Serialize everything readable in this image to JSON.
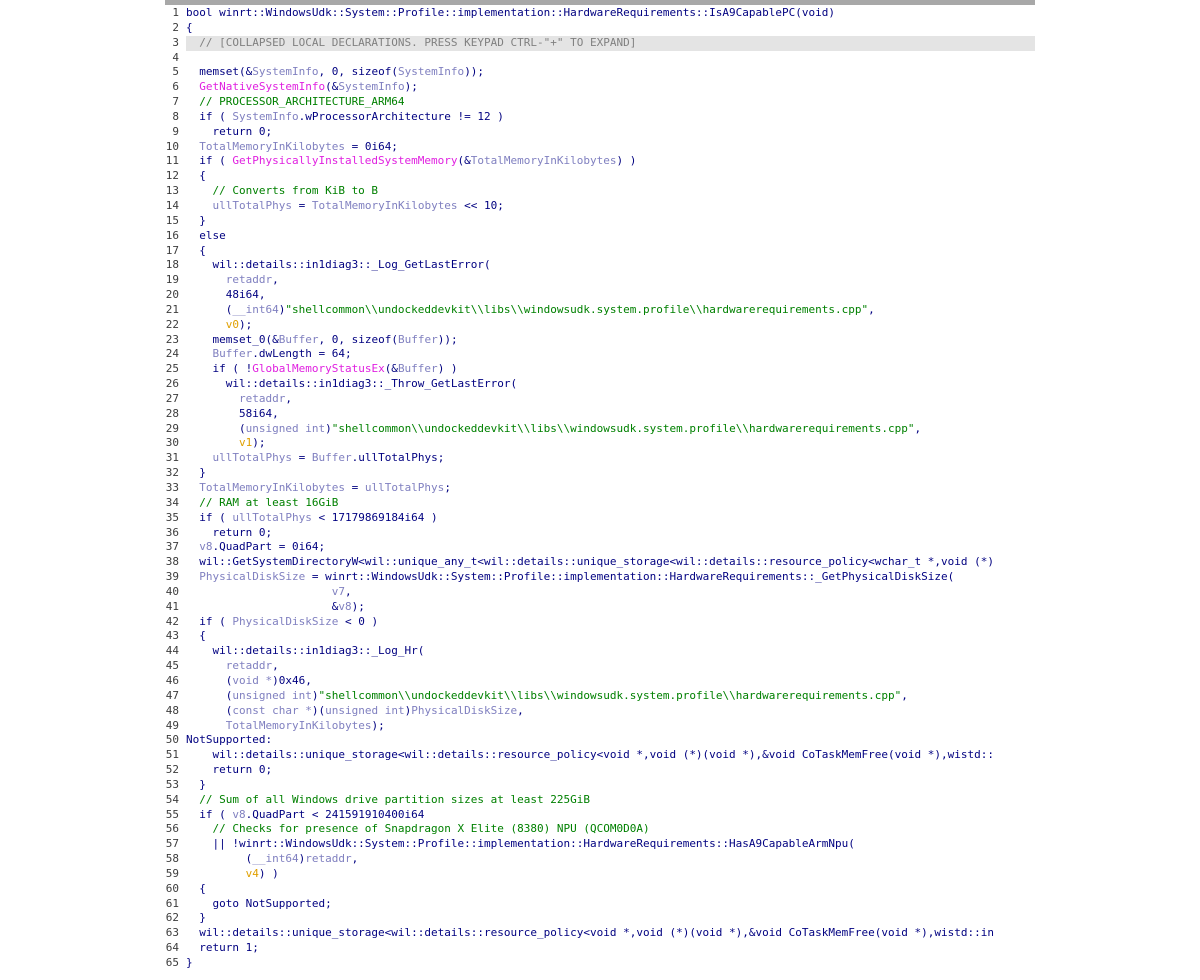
{
  "colors": {
    "plain": "#000080",
    "variable": "#8080c0",
    "import_function": "#e020e0",
    "comment": "#008000",
    "string": "#008000",
    "orange_variable": "#e0a000",
    "collapsed_text": "#808080",
    "collapsed_background": "#e4e4e4",
    "top_bar": "#a8a8a8"
  },
  "code_lines": [
    {
      "n": "1",
      "t": [
        [
          "p",
          "bool winrt::WindowsUdk::System::Profile::implementation::HardwareRequirements::IsA9CapablePC(void)"
        ]
      ]
    },
    {
      "n": "2",
      "t": [
        [
          "p",
          "{"
        ]
      ]
    },
    {
      "n": "3",
      "collapsed": true,
      "t": [
        [
          "g",
          "  // [COLLAPSED LOCAL DECLARATIONS. PRESS KEYPAD CTRL-\"+\" TO EXPAND]"
        ]
      ]
    },
    {
      "n": "4",
      "t": []
    },
    {
      "n": "5",
      "t": [
        [
          "p",
          "  memset(&"
        ],
        [
          "v",
          "SystemInfo"
        ],
        [
          "p",
          ", 0, sizeof("
        ],
        [
          "v",
          "SystemInfo"
        ],
        [
          "p",
          "));"
        ]
      ]
    },
    {
      "n": "6",
      "t": [
        [
          "p",
          "  "
        ],
        [
          "f",
          "GetNativeSystemInfo"
        ],
        [
          "p",
          "(&"
        ],
        [
          "v",
          "SystemInfo"
        ],
        [
          "p",
          ");"
        ]
      ]
    },
    {
      "n": "7",
      "t": [
        [
          "c",
          "  // PROCESSOR_ARCHITECTURE_ARM64"
        ]
      ]
    },
    {
      "n": "8",
      "t": [
        [
          "p",
          "  if ( "
        ],
        [
          "v",
          "SystemInfo"
        ],
        [
          "p",
          ".wProcessorArchitecture != 12 )"
        ]
      ]
    },
    {
      "n": "9",
      "t": [
        [
          "p",
          "    return 0;"
        ]
      ]
    },
    {
      "n": "10",
      "t": [
        [
          "p",
          "  "
        ],
        [
          "v",
          "TotalMemoryInKilobytes"
        ],
        [
          "p",
          " = 0i64;"
        ]
      ]
    },
    {
      "n": "11",
      "t": [
        [
          "p",
          "  if ( "
        ],
        [
          "f",
          "GetPhysicallyInstalledSystemMemory"
        ],
        [
          "p",
          "(&"
        ],
        [
          "v",
          "TotalMemoryInKilobytes"
        ],
        [
          "p",
          ") )"
        ]
      ]
    },
    {
      "n": "12",
      "t": [
        [
          "p",
          "  {"
        ]
      ]
    },
    {
      "n": "13",
      "t": [
        [
          "c",
          "    // Converts from KiB to B"
        ]
      ]
    },
    {
      "n": "14",
      "t": [
        [
          "p",
          "    "
        ],
        [
          "v",
          "ullTotalPhys"
        ],
        [
          "p",
          " = "
        ],
        [
          "v",
          "TotalMemoryInKilobytes"
        ],
        [
          "p",
          " << 10;"
        ]
      ]
    },
    {
      "n": "15",
      "t": [
        [
          "p",
          "  }"
        ]
      ]
    },
    {
      "n": "16",
      "t": [
        [
          "p",
          "  else"
        ]
      ]
    },
    {
      "n": "17",
      "t": [
        [
          "p",
          "  {"
        ]
      ]
    },
    {
      "n": "18",
      "t": [
        [
          "p",
          "    wil::details::in1diag3::_Log_GetLastError("
        ]
      ]
    },
    {
      "n": "19",
      "t": [
        [
          "p",
          "      "
        ],
        [
          "v",
          "retaddr"
        ],
        [
          "p",
          ","
        ]
      ]
    },
    {
      "n": "20",
      "t": [
        [
          "p",
          "      48i64,"
        ]
      ]
    },
    {
      "n": "21",
      "t": [
        [
          "p",
          "      ("
        ],
        [
          "v",
          "__int64"
        ],
        [
          "p",
          ")"
        ],
        [
          "s",
          "\"shellcommon\\\\undockeddevkit\\\\libs\\\\windowsudk.system.profile\\\\hardwarerequirements.cpp\""
        ],
        [
          "p",
          ","
        ]
      ]
    },
    {
      "n": "22",
      "t": [
        [
          "p",
          "      "
        ],
        [
          "o",
          "v0"
        ],
        [
          "p",
          ");"
        ]
      ]
    },
    {
      "n": "23",
      "t": [
        [
          "p",
          "    memset_0(&"
        ],
        [
          "v",
          "Buffer"
        ],
        [
          "p",
          ", 0, sizeof("
        ],
        [
          "v",
          "Buffer"
        ],
        [
          "p",
          "));"
        ]
      ]
    },
    {
      "n": "24",
      "t": [
        [
          "p",
          "    "
        ],
        [
          "v",
          "Buffer"
        ],
        [
          "p",
          ".dwLength = 64;"
        ]
      ]
    },
    {
      "n": "25",
      "t": [
        [
          "p",
          "    if ( !"
        ],
        [
          "f",
          "GlobalMemoryStatusEx"
        ],
        [
          "p",
          "(&"
        ],
        [
          "v",
          "Buffer"
        ],
        [
          "p",
          ") )"
        ]
      ]
    },
    {
      "n": "26",
      "t": [
        [
          "p",
          "      wil::details::in1diag3::_Throw_GetLastError("
        ]
      ]
    },
    {
      "n": "27",
      "t": [
        [
          "p",
          "        "
        ],
        [
          "v",
          "retaddr"
        ],
        [
          "p",
          ","
        ]
      ]
    },
    {
      "n": "28",
      "t": [
        [
          "p",
          "        58i64,"
        ]
      ]
    },
    {
      "n": "29",
      "t": [
        [
          "p",
          "        ("
        ],
        [
          "v",
          "unsigned int"
        ],
        [
          "p",
          ")"
        ],
        [
          "s",
          "\"shellcommon\\\\undockeddevkit\\\\libs\\\\windowsudk.system.profile\\\\hardwarerequirements.cpp\""
        ],
        [
          "p",
          ","
        ]
      ]
    },
    {
      "n": "30",
      "t": [
        [
          "p",
          "        "
        ],
        [
          "o",
          "v1"
        ],
        [
          "p",
          ");"
        ]
      ]
    },
    {
      "n": "31",
      "t": [
        [
          "p",
          "    "
        ],
        [
          "v",
          "ullTotalPhys"
        ],
        [
          "p",
          " = "
        ],
        [
          "v",
          "Buffer"
        ],
        [
          "p",
          ".ullTotalPhys;"
        ]
      ]
    },
    {
      "n": "32",
      "t": [
        [
          "p",
          "  }"
        ]
      ]
    },
    {
      "n": "33",
      "t": [
        [
          "p",
          "  "
        ],
        [
          "v",
          "TotalMemoryInKilobytes"
        ],
        [
          "p",
          " = "
        ],
        [
          "v",
          "ullTotalPhys"
        ],
        [
          "p",
          ";"
        ]
      ]
    },
    {
      "n": "34",
      "t": [
        [
          "c",
          "  // RAM at least 16GiB"
        ]
      ]
    },
    {
      "n": "35",
      "t": [
        [
          "p",
          "  if ( "
        ],
        [
          "v",
          "ullTotalPhys"
        ],
        [
          "p",
          " < 17179869184i64 )"
        ]
      ]
    },
    {
      "n": "36",
      "t": [
        [
          "p",
          "    return 0;"
        ]
      ]
    },
    {
      "n": "37",
      "t": [
        [
          "p",
          "  "
        ],
        [
          "v",
          "v8"
        ],
        [
          "p",
          ".QuadPart = 0i64;"
        ]
      ]
    },
    {
      "n": "38",
      "t": [
        [
          "p",
          "  wil::GetSystemDirectoryW<wil::unique_any_t<wil::details::unique_storage<wil::details::resource_policy<wchar_t *,void (*)"
        ]
      ]
    },
    {
      "n": "39",
      "t": [
        [
          "p",
          "  "
        ],
        [
          "v",
          "PhysicalDiskSize"
        ],
        [
          "p",
          " = winrt::WindowsUdk::System::Profile::implementation::HardwareRequirements::_GetPhysicalDiskSize("
        ]
      ]
    },
    {
      "n": "40",
      "t": [
        [
          "p",
          "                      "
        ],
        [
          "v",
          "v7"
        ],
        [
          "p",
          ","
        ]
      ]
    },
    {
      "n": "41",
      "t": [
        [
          "p",
          "                      &"
        ],
        [
          "v",
          "v8"
        ],
        [
          "p",
          ");"
        ]
      ]
    },
    {
      "n": "42",
      "t": [
        [
          "p",
          "  if ( "
        ],
        [
          "v",
          "PhysicalDiskSize"
        ],
        [
          "p",
          " < 0 )"
        ]
      ]
    },
    {
      "n": "43",
      "t": [
        [
          "p",
          "  {"
        ]
      ]
    },
    {
      "n": "44",
      "t": [
        [
          "p",
          "    wil::details::in1diag3::_Log_Hr("
        ]
      ]
    },
    {
      "n": "45",
      "t": [
        [
          "p",
          "      "
        ],
        [
          "v",
          "retaddr"
        ],
        [
          "p",
          ","
        ]
      ]
    },
    {
      "n": "46",
      "t": [
        [
          "p",
          "      ("
        ],
        [
          "v",
          "void *"
        ],
        [
          "p",
          ")0x46,"
        ]
      ]
    },
    {
      "n": "47",
      "t": [
        [
          "p",
          "      ("
        ],
        [
          "v",
          "unsigned int"
        ],
        [
          "p",
          ")"
        ],
        [
          "s",
          "\"shellcommon\\\\undockeddevkit\\\\libs\\\\windowsudk.system.profile\\\\hardwarerequirements.cpp\""
        ],
        [
          "p",
          ","
        ]
      ]
    },
    {
      "n": "48",
      "t": [
        [
          "p",
          "      ("
        ],
        [
          "v",
          "const char *"
        ],
        [
          "p",
          ")("
        ],
        [
          "v",
          "unsigned int"
        ],
        [
          "p",
          ")"
        ],
        [
          "v",
          "PhysicalDiskSize"
        ],
        [
          "p",
          ","
        ]
      ]
    },
    {
      "n": "49",
      "t": [
        [
          "p",
          "      "
        ],
        [
          "v",
          "TotalMemoryInKilobytes"
        ],
        [
          "p",
          ");"
        ]
      ]
    },
    {
      "n": "50",
      "t": [
        [
          "p",
          "NotSupported:"
        ]
      ]
    },
    {
      "n": "51",
      "t": [
        [
          "p",
          "    wil::details::unique_storage<wil::details::resource_policy<void *,void (*)(void *),&void CoTaskMemFree(void *),wistd::"
        ]
      ]
    },
    {
      "n": "52",
      "t": [
        [
          "p",
          "    return 0;"
        ]
      ]
    },
    {
      "n": "53",
      "t": [
        [
          "p",
          "  }"
        ]
      ]
    },
    {
      "n": "54",
      "t": [
        [
          "c",
          "  // Sum of all Windows drive partition sizes at least 225GiB"
        ]
      ]
    },
    {
      "n": "55",
      "t": [
        [
          "p",
          "  if ( "
        ],
        [
          "v",
          "v8"
        ],
        [
          "p",
          ".QuadPart < 241591910400i64"
        ]
      ]
    },
    {
      "n": "56",
      "t": [
        [
          "c",
          "    // Checks for presence of Snapdragon X Elite (8380) NPU (QCOM0D0A)"
        ]
      ]
    },
    {
      "n": "57",
      "t": [
        [
          "p",
          "    || !winrt::WindowsUdk::System::Profile::implementation::HardwareRequirements::HasA9CapableArmNpu("
        ]
      ]
    },
    {
      "n": "58",
      "t": [
        [
          "p",
          "         ("
        ],
        [
          "v",
          "__int64"
        ],
        [
          "p",
          ")"
        ],
        [
          "v",
          "retaddr"
        ],
        [
          "p",
          ","
        ]
      ]
    },
    {
      "n": "59",
      "t": [
        [
          "p",
          "         "
        ],
        [
          "o",
          "v4"
        ],
        [
          "p",
          ") )"
        ]
      ]
    },
    {
      "n": "60",
      "t": [
        [
          "p",
          "  {"
        ]
      ]
    },
    {
      "n": "61",
      "t": [
        [
          "p",
          "    goto NotSupported;"
        ]
      ]
    },
    {
      "n": "62",
      "t": [
        [
          "p",
          "  }"
        ]
      ]
    },
    {
      "n": "63",
      "t": [
        [
          "p",
          "  wil::details::unique_storage<wil::details::resource_policy<void *,void (*)(void *),&void CoTaskMemFree(void *),wistd::in"
        ]
      ]
    },
    {
      "n": "64",
      "t": [
        [
          "p",
          "  return 1;"
        ]
      ]
    },
    {
      "n": "65",
      "t": [
        [
          "p",
          "}"
        ]
      ]
    }
  ]
}
